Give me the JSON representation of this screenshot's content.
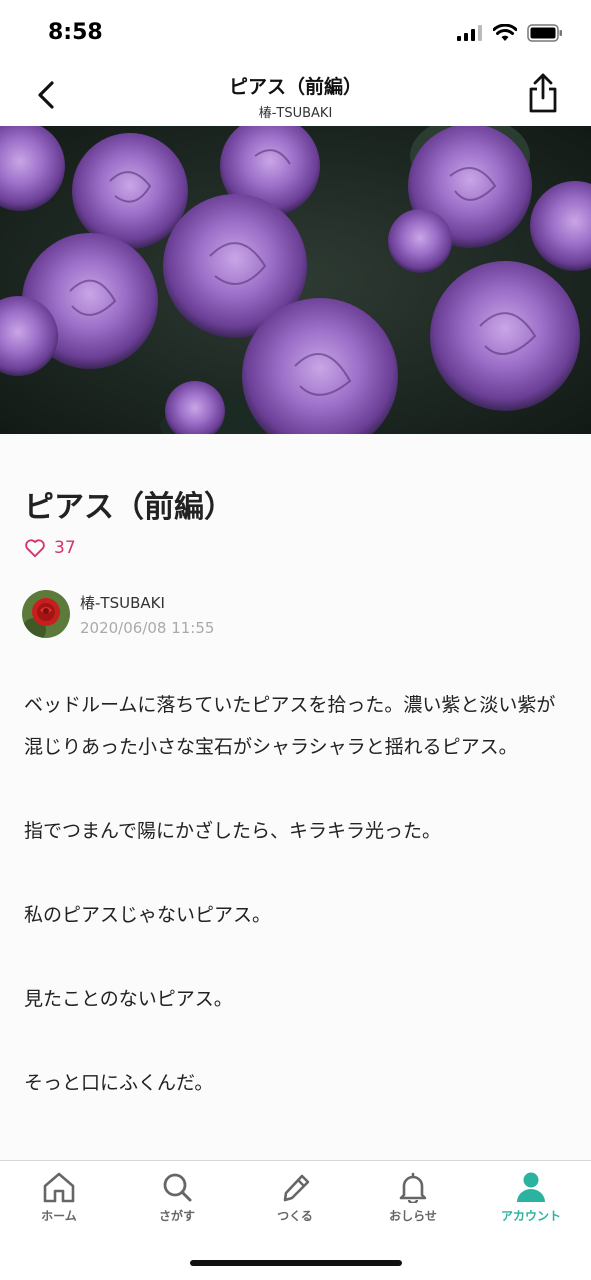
{
  "status_bar": {
    "time": "8:58"
  },
  "nav": {
    "title": "ピアス（前編）",
    "subtitle": "椿-TSUBAKI"
  },
  "article": {
    "title": "ピアス（前編）",
    "like_count": "37",
    "author_name": "椿-TSUBAKI",
    "date": "2020/06/08 11:55",
    "paragraphs": [
      "ベッドルームに落ちていたピアスを拾った。濃い紫と淡い紫が混じりあった小さな宝石がシャラシャラと揺れるピアス。",
      "指でつまんで陽にかざしたら、キラキラ光った。",
      "私のピアスじゃないピアス。",
      "見たことのないピアス。",
      "そっと口にふくんだ。"
    ]
  },
  "tabs": [
    {
      "label": "ホーム",
      "icon": "home-icon"
    },
    {
      "label": "さがす",
      "icon": "search-icon"
    },
    {
      "label": "つくる",
      "icon": "pencil-icon"
    },
    {
      "label": "おしらせ",
      "icon": "bell-icon"
    },
    {
      "label": "アカウント",
      "icon": "person-icon"
    }
  ],
  "colors": {
    "accent": "#2bb3a0",
    "like": "#d6336c"
  }
}
